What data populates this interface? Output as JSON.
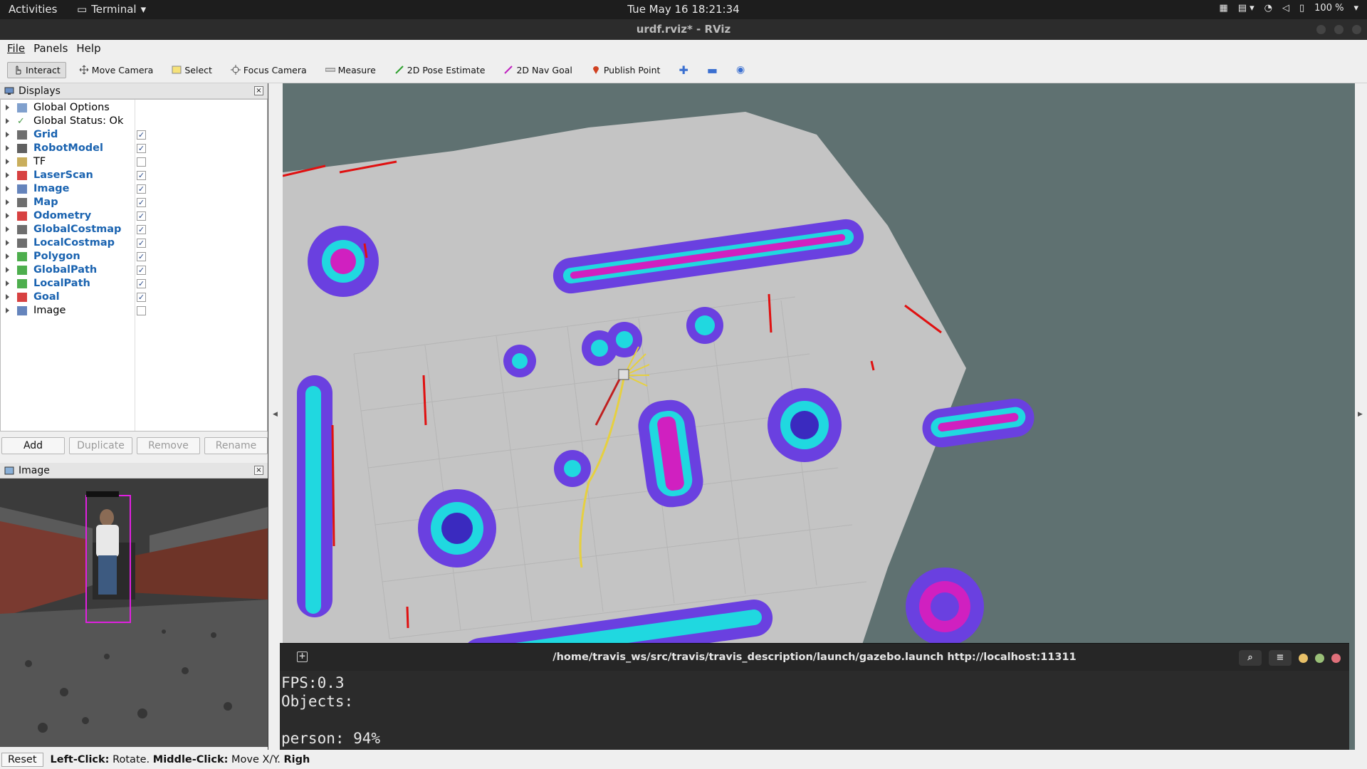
{
  "topbar": {
    "activities": "Activities",
    "app": "Terminal",
    "clock": "Tue May 16  18:21:34",
    "battery": "100 %"
  },
  "window": {
    "title": "urdf.rviz* - RViz"
  },
  "menu": {
    "file": "File",
    "panels": "Panels",
    "help": "Help"
  },
  "toolbar": {
    "interact": "Interact",
    "move_camera": "Move Camera",
    "select": "Select",
    "focus_camera": "Focus Camera",
    "measure": "Measure",
    "pose_estimate": "2D Pose Estimate",
    "nav_goal": "2D Nav Goal",
    "publish_point": "Publish Point"
  },
  "displays": {
    "title": "Displays",
    "items": [
      {
        "label": "Global Options",
        "checked": null,
        "bold": false
      },
      {
        "label": "Global Status: Ok",
        "checked": null,
        "bold": false
      },
      {
        "label": "Grid",
        "checked": true,
        "bold": true
      },
      {
        "label": "RobotModel",
        "checked": true,
        "bold": true
      },
      {
        "label": "TF",
        "checked": false,
        "bold": false
      },
      {
        "label": "LaserScan",
        "checked": true,
        "bold": true
      },
      {
        "label": "Image",
        "checked": true,
        "bold": true
      },
      {
        "label": "Map",
        "checked": true,
        "bold": true
      },
      {
        "label": "Odometry",
        "checked": true,
        "bold": true
      },
      {
        "label": "GlobalCostmap",
        "checked": true,
        "bold": true
      },
      {
        "label": "LocalCostmap",
        "checked": true,
        "bold": true
      },
      {
        "label": "Polygon",
        "checked": true,
        "bold": true
      },
      {
        "label": "GlobalPath",
        "checked": true,
        "bold": true
      },
      {
        "label": "LocalPath",
        "checked": true,
        "bold": true
      },
      {
        "label": "Goal",
        "checked": true,
        "bold": true
      },
      {
        "label": "Image",
        "checked": false,
        "bold": false
      }
    ],
    "buttons": {
      "add": "Add",
      "duplicate": "Duplicate",
      "remove": "Remove",
      "rename": "Rename"
    }
  },
  "image_panel": {
    "title": "Image"
  },
  "terminal": {
    "title": "/home/travis_ws/src/travis/travis_description/launch/gazebo.launch http://localhost:11311",
    "lines": [
      "FPS:0.3",
      "Objects:",
      "",
      "person: 94%"
    ]
  },
  "status": {
    "reset": "Reset",
    "left_click": "Left-Click:",
    "left_click_desc": "Rotate.",
    "middle_click": "Middle-Click:",
    "middle_click_desc": "Move X/Y.",
    "right": "Righ"
  }
}
